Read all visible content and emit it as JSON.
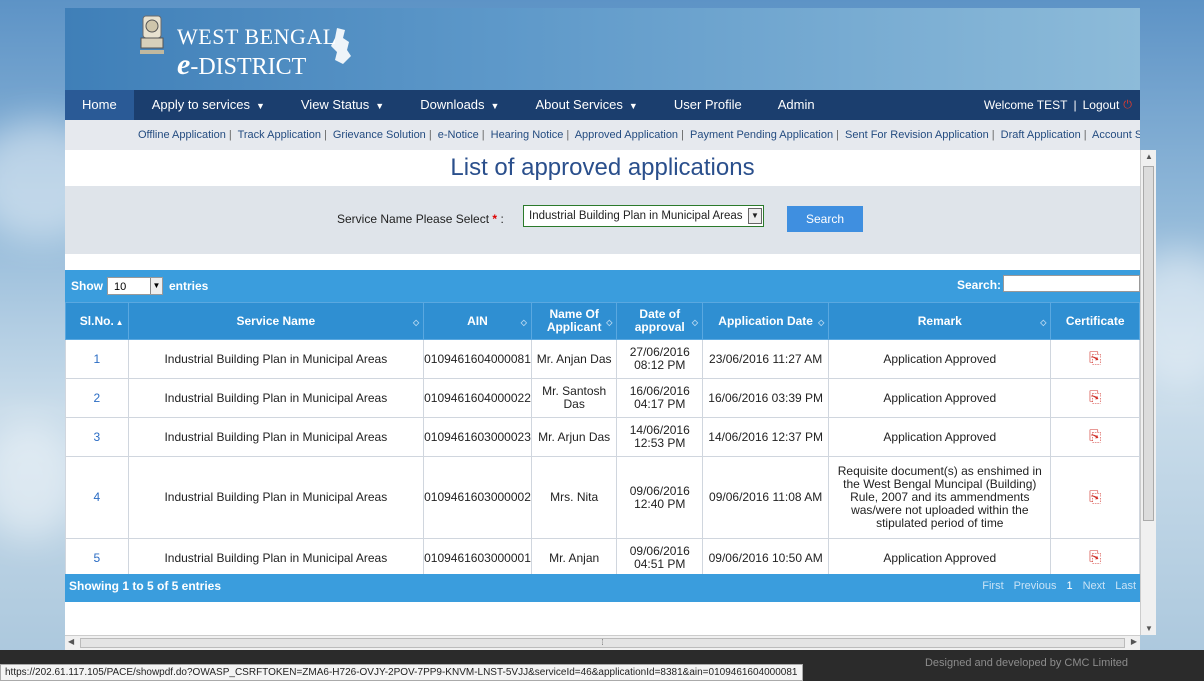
{
  "header": {
    "title_line1": "WEST BENGAL",
    "title_e": "e",
    "title_line2": "-DISTRICT"
  },
  "nav": {
    "items": [
      {
        "label": "Home"
      },
      {
        "label": "Apply to services",
        "dropdown": true
      },
      {
        "label": "View Status",
        "dropdown": true
      },
      {
        "label": "Downloads",
        "dropdown": true
      },
      {
        "label": "About Services",
        "dropdown": true
      },
      {
        "label": "User Profile"
      },
      {
        "label": "Admin"
      }
    ],
    "welcome": "Welcome TEST",
    "logout": "Logout"
  },
  "subnav": [
    "Offline Application",
    "Track Application",
    "Grievance Solution",
    "e-Notice",
    "Hearing Notice",
    "Approved Application",
    "Payment Pending Application",
    "Sent For Revision Application",
    "Draft Application",
    "Account Statement"
  ],
  "page_title": "List of approved applications",
  "filter": {
    "label": "Service Name Please Select",
    "required_mark": "*",
    "colon": ":",
    "selected": "Industrial Building Plan in Municipal Areas",
    "search_label": "Search"
  },
  "table_controls": {
    "show": "Show",
    "length": "10",
    "entries": "entries",
    "search_label": "Search:"
  },
  "columns": [
    "Sl.No.",
    "Service Name",
    "AIN",
    "Name Of Applicant",
    "Date of approval",
    "Application Date",
    "Remark",
    "Certificate"
  ],
  "rows": [
    {
      "sl": "1",
      "service": "Industrial Building Plan in Municipal Areas",
      "ain": "0109461604000081",
      "applicant": "Mr. Anjan Das",
      "approval": "27/06/2016 08:12 PM",
      "app_date": "23/06/2016 11:27 AM",
      "remark": "Application Approved"
    },
    {
      "sl": "2",
      "service": "Industrial Building Plan in Municipal Areas",
      "ain": "0109461604000022",
      "applicant": "Mr. Santosh Das",
      "approval": "16/06/2016 04:17 PM",
      "app_date": "16/06/2016 03:39 PM",
      "remark": "Application Approved"
    },
    {
      "sl": "3",
      "service": "Industrial Building Plan in Municipal Areas",
      "ain": "0109461603000023",
      "applicant": "Mr. Arjun Das",
      "approval": "14/06/2016 12:53 PM",
      "app_date": "14/06/2016 12:37 PM",
      "remark": "Application Approved"
    },
    {
      "sl": "4",
      "service": "Industrial Building Plan in Municipal Areas",
      "ain": "0109461603000002",
      "applicant": "Mrs. Nita",
      "approval": "09/06/2016 12:40 PM",
      "app_date": "09/06/2016 11:08 AM",
      "remark": "Requisite document(s) as enshimed in the West Bengal Muncipal (Building) Rule, 2007 and its ammendments was/were not uploaded within the stipulated period of time"
    },
    {
      "sl": "5",
      "service": "Industrial Building Plan in Municipal Areas",
      "ain": "0109461603000001",
      "applicant": "Mr. Anjan",
      "approval": "09/06/2016 04:51 PM",
      "app_date": "09/06/2016 10:50 AM",
      "remark": "Application Approved"
    }
  ],
  "table_footer": {
    "info": "Showing 1 to 5 of 5 entries",
    "pager": [
      "First",
      "Previous",
      "1",
      "Next",
      "Last"
    ]
  },
  "footer": {
    "credit": "Designed and developed by CMC Limited",
    "status_url": "https://202.61.117.105/PACE/showpdf.do?OWASP_CSRFTOKEN=ZMA6-H726-OVJY-2POV-7PP9-KNVM-LNST-5VJJ&serviceId=46&applicationId=8381&ain=0109461604000081"
  },
  "colors": {
    "nav_bg": "#1b3e6e",
    "table_header": "#2f8fd2",
    "accent": "#3a9ddd"
  },
  "icons": {
    "certificate": "pdf-icon",
    "logout": "power-icon"
  }
}
